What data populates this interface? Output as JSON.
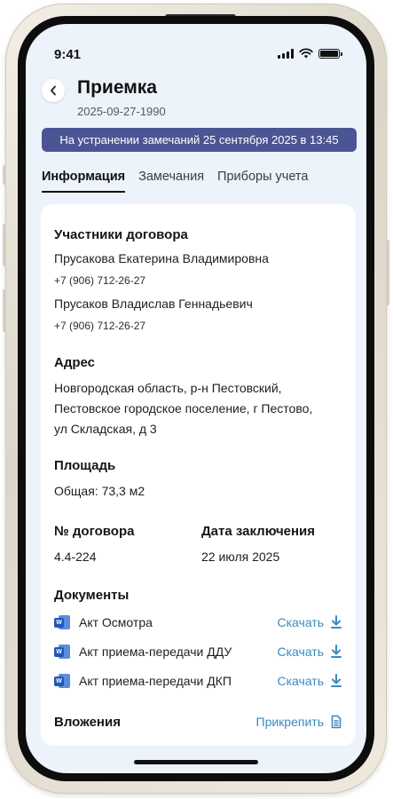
{
  "status_bar": {
    "time": "9:41"
  },
  "header": {
    "title": "Приемка",
    "subtitle": "2025-09-27-1990",
    "banner": "На устранении замечаний 25 сентября 2025 в 13:45"
  },
  "tabs": [
    {
      "label": "Информация",
      "active": true
    },
    {
      "label": "Замечания",
      "active": false
    },
    {
      "label": "Приборы учета",
      "active": false
    }
  ],
  "participants": {
    "title": "Участники договора",
    "people": [
      {
        "name": "Прусакова Екатерина Владимировна",
        "phone": "+7 (906) 712-26-27"
      },
      {
        "name": "Прусаков Владислав Геннадьевич",
        "phone": "+7 (906) 712-26-27"
      }
    ]
  },
  "address": {
    "title": "Адрес",
    "lines": [
      "Новгородская область, р-н Пестовский,",
      "Пестовское городское поселение, г Пестово,",
      "ул Складская, д 3"
    ]
  },
  "area": {
    "title": "Площадь",
    "value": "Общая: 73,3 м2"
  },
  "contract": {
    "number_title": "№ договора",
    "number_value": "4.4-224",
    "date_title": "Дата заключения",
    "date_value": "22 июля 2025"
  },
  "documents": {
    "title": "Документы",
    "download_label": "Скачать",
    "items": [
      {
        "name": "Акт Осмотра"
      },
      {
        "name": "Акт приема-передачи ДДУ"
      },
      {
        "name": "Акт приема-передачи ДКП"
      }
    ]
  },
  "attachments": {
    "title": "Вложения",
    "attach_label": "Прикрепить"
  },
  "colors": {
    "banner": "#4c5593",
    "link": "#3a8bbf",
    "background": "#edf3fb"
  }
}
